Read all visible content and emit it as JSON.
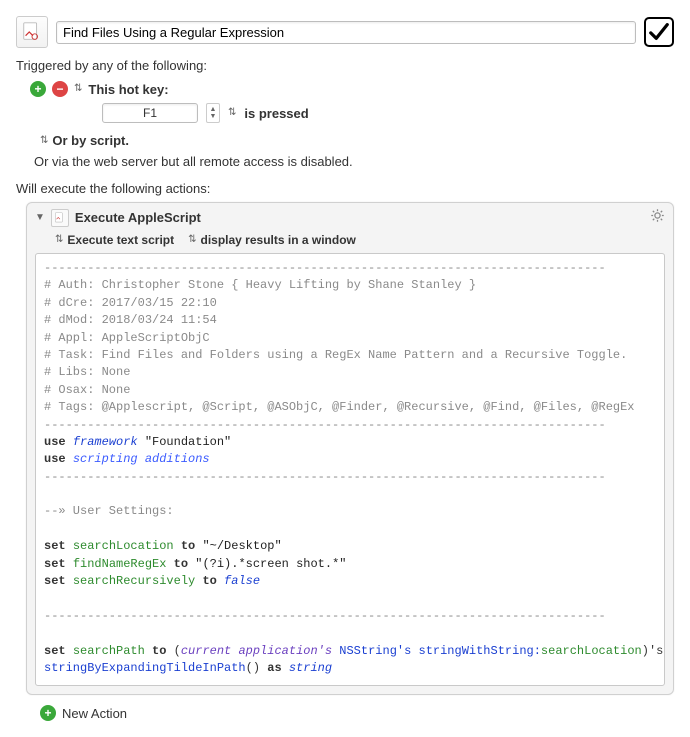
{
  "header": {
    "title_value": "Find Files Using a Regular Expression"
  },
  "triggers": {
    "section_label": "Triggered by any of the following:",
    "hotkey_label": "This hot key:",
    "hotkey_value": "F1",
    "pressed_label": "is pressed",
    "or_script_label": "Or by script.",
    "remote_label": "Or via the web server but all remote access is disabled."
  },
  "actions": {
    "section_label": "Will execute the following actions:",
    "title": "Execute AppleScript",
    "mode_label": "Execute text script",
    "results_label": "display results in a window"
  },
  "script": {
    "sep": "------------------------------------------------------------------------------",
    "h_auth": "# Auth: Christopher Stone { Heavy Lifting by Shane Stanley }",
    "h_dcre": "# dCre: 2017/03/15 22:10",
    "h_dmod": "# dMod: 2018/03/24 11:54",
    "h_appl": "# Appl: AppleScriptObjC",
    "h_task": "# Task: Find Files and Folders using a RegEx Name Pattern and a Recursive Toggle.",
    "h_libs": "# Libs: None",
    "h_osax": "# Osax: None",
    "h_tags": "# Tags: @Applescript, @Script, @ASObjC, @Finder, @Recursive, @Find, @Files, @RegEx",
    "use": "use",
    "framework": "framework",
    "foundation_q": "\"Foundation\"",
    "scripting_additions": "scripting additions",
    "user_settings": "--» User Settings:",
    "set": "set",
    "to": "to",
    "searchLocation": "searchLocation",
    "searchLocation_val": "\"~/Desktop\"",
    "findNameRegEx": "findNameRegEx",
    "findNameRegEx_val": "\"(?i).*screen shot.*\"",
    "searchRecursively": "searchRecursively",
    "false": "false",
    "searchPath": "searchPath",
    "curr_app": "current application's",
    "nsstring": "NSString's",
    "stringWith": "stringWithString:",
    "paren_close_ap": ")'s",
    "expandTilde": "stringByExpandingTildeInPath",
    "parens_empty": "()",
    "as": "as",
    "string": "string",
    "open_paren": "("
  },
  "footer": {
    "new_action": "New Action"
  }
}
